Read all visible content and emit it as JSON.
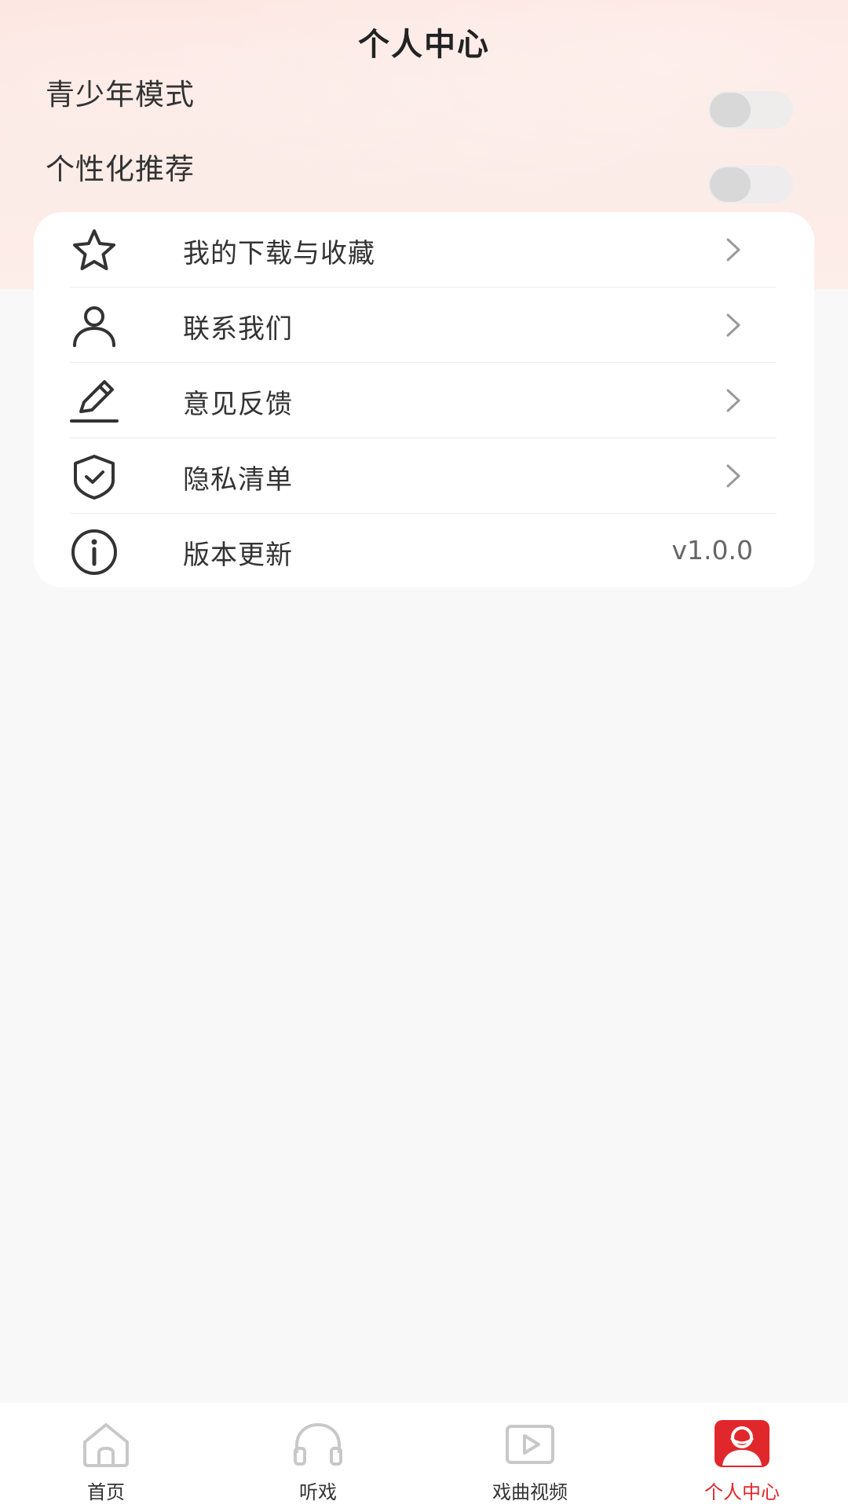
{
  "header": {
    "title": "个人中心"
  },
  "toggles": [
    {
      "label": "青少年模式",
      "on": false,
      "icon": "toggle-switch"
    },
    {
      "label": "个性化推荐",
      "on": false,
      "icon": "toggle-switch"
    }
  ],
  "menu": {
    "items": [
      {
        "label": "我的下载与收藏",
        "icon": "star-icon"
      },
      {
        "label": "联系我们",
        "icon": "user-icon"
      },
      {
        "label": "意见反馈",
        "icon": "pencil-icon"
      },
      {
        "label": "隐私清单",
        "icon": "shield-check-icon"
      },
      {
        "label": "版本更新",
        "icon": "info-icon",
        "value": "v1.0.0"
      }
    ]
  },
  "bottom_nav": {
    "items": [
      {
        "label": "首页",
        "icon": "home-icon",
        "active": false
      },
      {
        "label": "听戏",
        "icon": "headphones-icon",
        "active": false
      },
      {
        "label": "戏曲视频",
        "icon": "video-play-icon",
        "active": false
      },
      {
        "label": "个人中心",
        "icon": "profile-icon",
        "active": true
      }
    ]
  },
  "colors": {
    "accent": "#e0282c",
    "inactive_icon": "#c8c8c8",
    "header_bg": "#fde4df",
    "page_bg": "#f8f8f8"
  }
}
